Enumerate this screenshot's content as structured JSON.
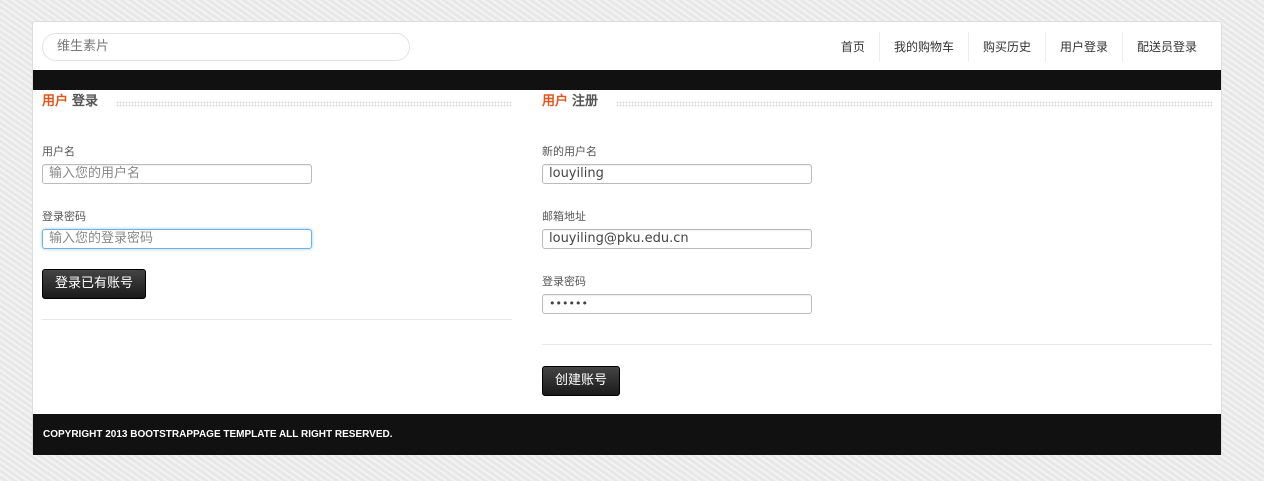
{
  "header": {
    "search_text": "维生素片",
    "nav": [
      "首页",
      "我的购物车",
      "购买历史",
      "用户登录",
      "配送员登录"
    ]
  },
  "login": {
    "title_highlight": "用户",
    "title_rest": "登录",
    "username_label": "用户名",
    "username_placeholder": "输入您的用户名",
    "password_label": "登录密码",
    "password_placeholder": "输入您的登录密码",
    "submit_label": "登录已有账号"
  },
  "register": {
    "title_highlight": "用户",
    "title_rest": "注册",
    "username_label": "新的用户名",
    "username_value": "louyiling",
    "email_label": "邮箱地址",
    "email_value": "louyiling@pku.edu.cn",
    "password_label": "登录密码",
    "password_value": "••••••",
    "submit_label": "创建账号"
  },
  "footer": {
    "text": "COPYRIGHT 2013 BOOTSTRAPPAGE TEMPLATE ALL RIGHT RESERVED."
  },
  "colors": {
    "accent": "#e0561c",
    "bar": "#111111"
  }
}
